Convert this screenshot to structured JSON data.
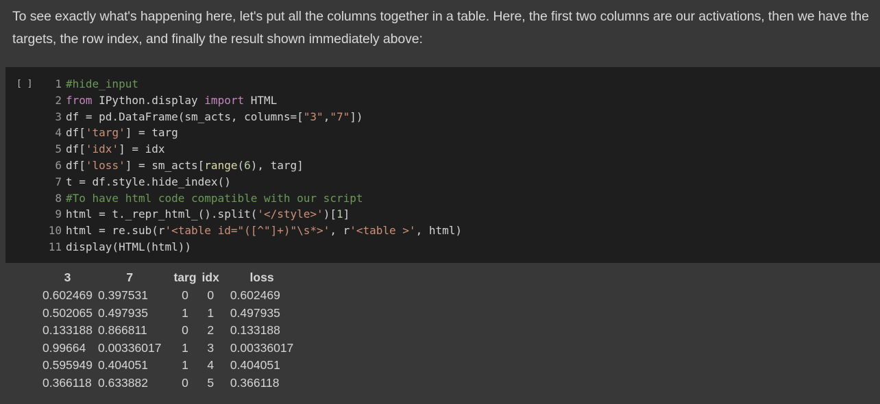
{
  "markdown": {
    "text": "To see exactly what's happening here, let's put all the columns together in a table. Here, the first two columns are our activations, then we have the targets, the row index, and finally the result shown immediately above:"
  },
  "code_cell": {
    "run_button": "[ ]",
    "lines": [
      {
        "n": "1",
        "tokens": [
          {
            "t": "#hide_input",
            "c": "cm"
          }
        ]
      },
      {
        "n": "2",
        "tokens": [
          {
            "t": "from",
            "c": "kw"
          },
          {
            "t": " IPython.display ",
            "c": ""
          },
          {
            "t": "import",
            "c": "kw"
          },
          {
            "t": " HTML",
            "c": ""
          }
        ]
      },
      {
        "n": "3",
        "tokens": [
          {
            "t": "df = pd.DataFrame(sm_acts, columns=[",
            "c": ""
          },
          {
            "t": "\"3\"",
            "c": "str"
          },
          {
            "t": ",",
            "c": ""
          },
          {
            "t": "\"7\"",
            "c": "str"
          },
          {
            "t": "])",
            "c": ""
          }
        ]
      },
      {
        "n": "4",
        "tokens": [
          {
            "t": "df[",
            "c": ""
          },
          {
            "t": "'targ'",
            "c": "str"
          },
          {
            "t": "] = targ",
            "c": ""
          }
        ]
      },
      {
        "n": "5",
        "tokens": [
          {
            "t": "df[",
            "c": ""
          },
          {
            "t": "'idx'",
            "c": "str"
          },
          {
            "t": "] = idx",
            "c": ""
          }
        ]
      },
      {
        "n": "6",
        "tokens": [
          {
            "t": "df[",
            "c": ""
          },
          {
            "t": "'loss'",
            "c": "str"
          },
          {
            "t": "] = sm_acts[",
            "c": ""
          },
          {
            "t": "range",
            "c": "fn"
          },
          {
            "t": "(",
            "c": ""
          },
          {
            "t": "6",
            "c": "num"
          },
          {
            "t": "), targ]",
            "c": ""
          }
        ]
      },
      {
        "n": "7",
        "tokens": [
          {
            "t": "t = df.style.hide_index()",
            "c": ""
          }
        ]
      },
      {
        "n": "8",
        "tokens": [
          {
            "t": "#To have html code compatible with our script",
            "c": "cm"
          }
        ]
      },
      {
        "n": "9",
        "tokens": [
          {
            "t": "html = t._repr_html_().split(",
            "c": ""
          },
          {
            "t": "'</style>'",
            "c": "str"
          },
          {
            "t": ")[",
            "c": ""
          },
          {
            "t": "1",
            "c": "num"
          },
          {
            "t": "]",
            "c": ""
          }
        ]
      },
      {
        "n": "10",
        "tokens": [
          {
            "t": "html = re.sub(r",
            "c": ""
          },
          {
            "t": "'<table id=\"([^\"]+)\"\\s*>'",
            "c": "str"
          },
          {
            "t": ", r",
            "c": ""
          },
          {
            "t": "'<table >'",
            "c": "str"
          },
          {
            "t": ", html)",
            "c": ""
          }
        ]
      },
      {
        "n": "11",
        "tokens": [
          {
            "t": "display(HTML(html))",
            "c": ""
          }
        ]
      }
    ]
  },
  "output_table": {
    "headers": [
      "3",
      "7",
      "targ",
      "idx",
      "loss"
    ],
    "rows": [
      [
        "0.602469",
        "0.397531",
        "0",
        "0",
        "0.602469"
      ],
      [
        "0.502065",
        "0.497935",
        "1",
        "1",
        "0.497935"
      ],
      [
        "0.133188",
        "0.866811",
        "0",
        "2",
        "0.133188"
      ],
      [
        "0.99664",
        "0.00336017",
        "1",
        "3",
        "0.00336017"
      ],
      [
        "0.595949",
        "0.404051",
        "1",
        "4",
        "0.404051"
      ],
      [
        "0.366118",
        "0.633882",
        "0",
        "5",
        "0.366118"
      ]
    ]
  }
}
